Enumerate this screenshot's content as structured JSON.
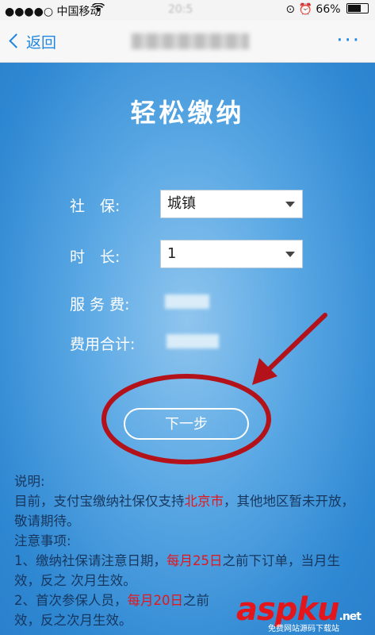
{
  "status_bar": {
    "carrier": "●●●●○ 中国移动",
    "time": "20:5",
    "battery": "66%"
  },
  "nav": {
    "back_label": "返回",
    "title": "",
    "more_label": "···"
  },
  "form": {
    "title": "轻松缴纳",
    "social_label": "社　保:",
    "social_value": "城镇",
    "duration_label": "时　长:",
    "duration_value": "1",
    "service_fee_label": "服 务 费:",
    "total_label": "费用合计:",
    "next_button": "下一步"
  },
  "notes": {
    "heading": "说明:",
    "line1_a": "目前，支付宝缴纳社保仅支持",
    "line1_red": "北京市",
    "line1_b": "，其他地区暂未开放，敬请期待。",
    "heading2": "注意事项:",
    "item1_a": "1、缴纳社保请注意日期，",
    "item1_red": "每月25日",
    "item1_b": "之前下订单，当月生效，反之 次月生效。",
    "item2_a": "2、首次参保人员，",
    "item2_red": "每月20日",
    "item2_b": "之前",
    "item2_c": "效，反之次月生效。"
  },
  "watermark": {
    "brand": "aspku",
    "domain": ".net",
    "subtitle": "免费网站源码下载站"
  },
  "colors": {
    "accent_blue": "#1f86e0",
    "annotation_red": "#b3121a",
    "highlight_red": "#e3161c"
  }
}
